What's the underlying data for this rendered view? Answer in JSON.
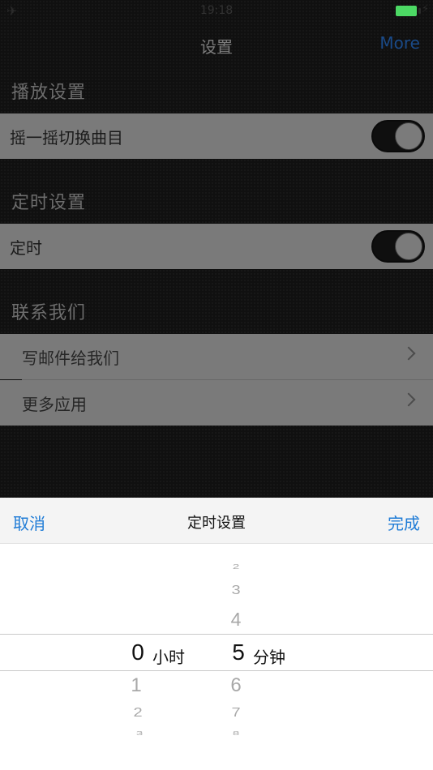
{
  "status_bar": {
    "airplane_icon": "airplane-icon",
    "time": "19:18",
    "battery_icon": "battery-icon"
  },
  "nav": {
    "title": "设置",
    "more": "More"
  },
  "sections": {
    "playback": {
      "header": "播放设置",
      "shake_label": "摇一摇切换曲目",
      "shake_on": true
    },
    "timer": {
      "header": "定时设置",
      "timer_label": "定时",
      "timer_on": true
    },
    "contact": {
      "header": "联系我们",
      "email_label": "写邮件给我们",
      "more_apps_label": "更多应用"
    }
  },
  "picker": {
    "cancel": "取消",
    "title": "定时设置",
    "done": "完成",
    "hours": {
      "above": [
        "",
        "",
        ""
      ],
      "selected": "0",
      "below": [
        "1",
        "2",
        "3"
      ],
      "unit": "小时"
    },
    "minutes": {
      "above": [
        "2",
        "3",
        "4"
      ],
      "selected": "5",
      "below": [
        "6",
        "7",
        "8"
      ],
      "unit": "分钟"
    }
  },
  "colors": {
    "accent": "#1e7bd6",
    "nav_more": "#1a4a88",
    "battery": "#4cd964"
  }
}
